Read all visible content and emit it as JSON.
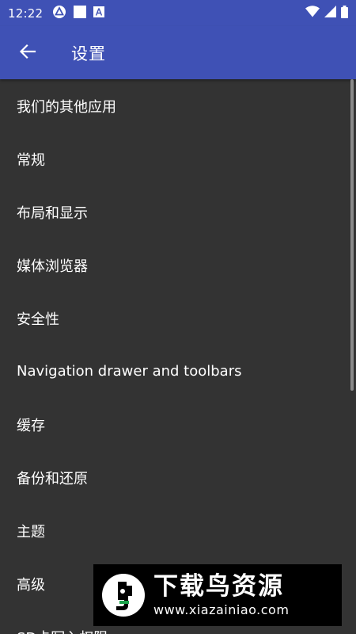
{
  "status_bar": {
    "time": "12:22",
    "left_icons": [
      "sync-icon",
      "square-notification-icon",
      "a-notification-icon"
    ],
    "right_icons": [
      "wifi-icon",
      "cellular-icon",
      "battery-icon"
    ]
  },
  "app_bar": {
    "back_icon": "arrow-back-icon",
    "title": "设置",
    "color": "#3F51B5"
  },
  "settings": {
    "items": [
      {
        "label": "我们的其他应用"
      },
      {
        "label": "常规"
      },
      {
        "label": "布局和显示"
      },
      {
        "label": "媒体浏览器"
      },
      {
        "label": "安全性"
      },
      {
        "label": "Navigation drawer and toolbars"
      },
      {
        "label": "缓存"
      },
      {
        "label": "备份和还原"
      },
      {
        "label": "主题"
      },
      {
        "label": "高级"
      },
      {
        "label": "SD卡写入权限"
      }
    ]
  },
  "watermark": {
    "title": "下载鸟资源",
    "url": "www.xiazainiao.com"
  },
  "colors": {
    "primary": "#3F51B5",
    "background": "#333333",
    "text": "#FFFFFF"
  }
}
